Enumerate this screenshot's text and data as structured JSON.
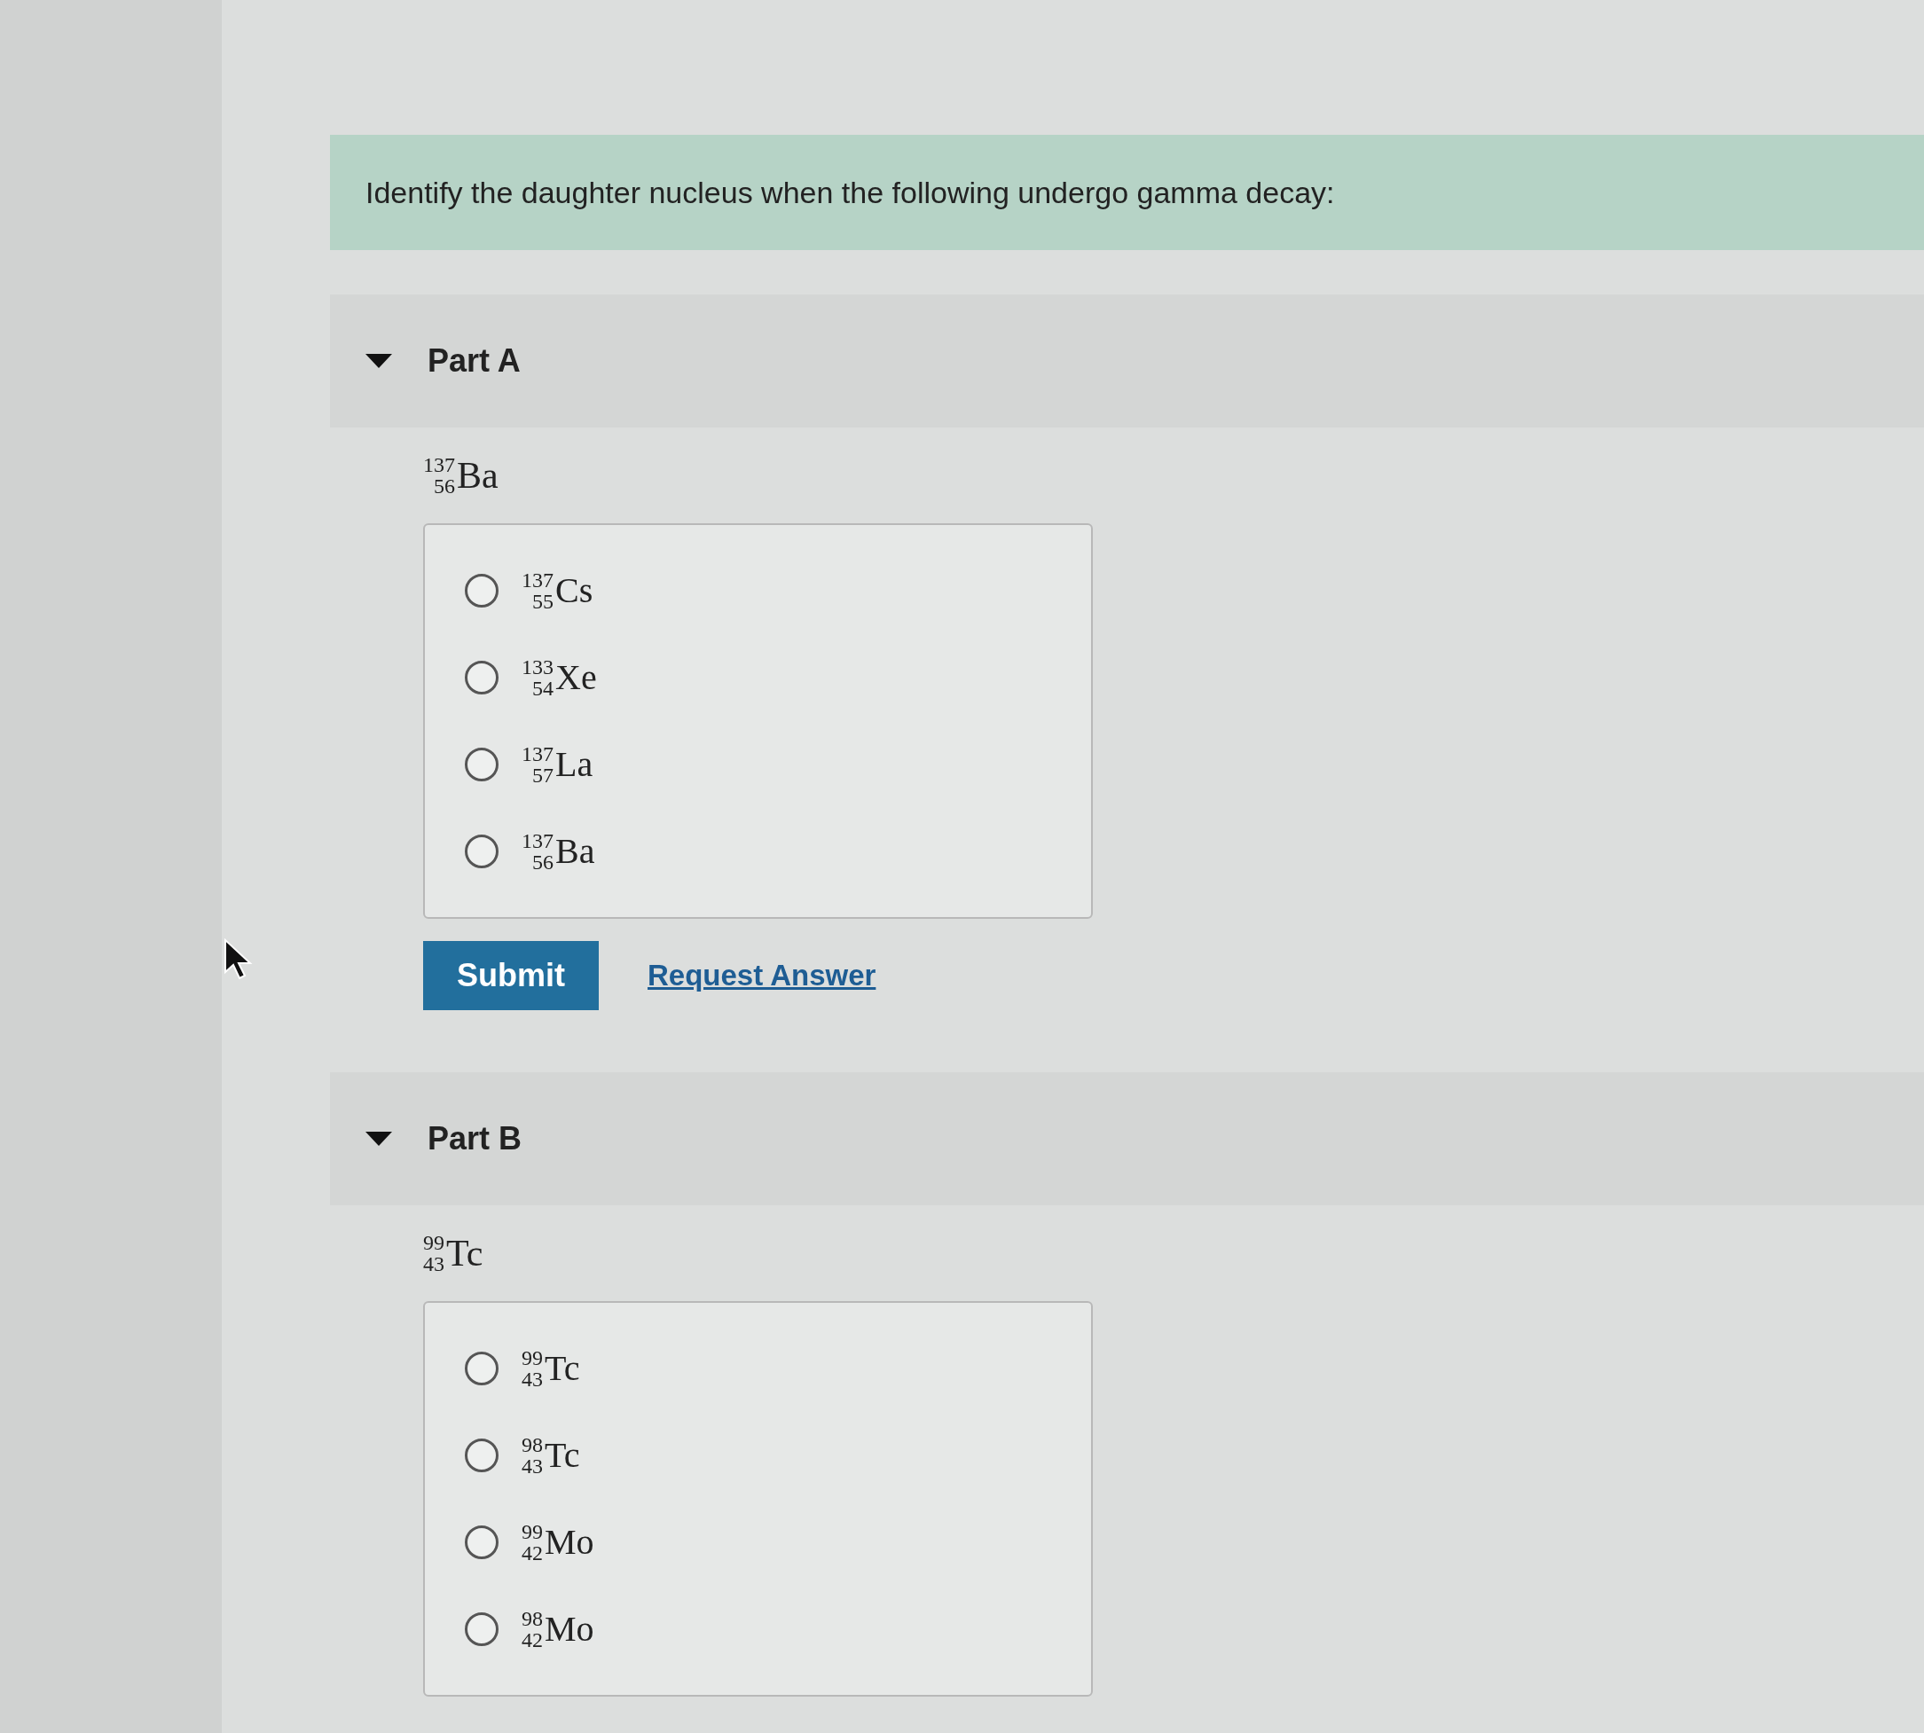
{
  "question": "Identify the daughter nucleus when the following undergo gamma decay:",
  "parts": [
    {
      "title": "Part A",
      "expanded": true,
      "nuclide": {
        "mass": "137",
        "number": "56",
        "symbol": "Ba"
      },
      "options": [
        {
          "mass": "137",
          "number": "55",
          "symbol": "Cs",
          "selected": false
        },
        {
          "mass": "133",
          "number": "54",
          "symbol": "Xe",
          "selected": false
        },
        {
          "mass": "137",
          "number": "57",
          "symbol": "La",
          "selected": false
        },
        {
          "mass": "137",
          "number": "56",
          "symbol": "Ba",
          "selected": false
        }
      ],
      "submit": "Submit",
      "request": "Request Answer"
    },
    {
      "title": "Part B",
      "expanded": true,
      "nuclide": {
        "mass": "99",
        "number": "43",
        "symbol": "Tc"
      },
      "options": [
        {
          "mass": "99",
          "number": "43",
          "symbol": "Tc",
          "selected": false
        },
        {
          "mass": "98",
          "number": "43",
          "symbol": "Tc",
          "selected": false
        },
        {
          "mass": "99",
          "number": "42",
          "symbol": "Mo",
          "selected": false
        },
        {
          "mass": "98",
          "number": "42",
          "symbol": "Mo",
          "selected": false
        }
      ]
    }
  ]
}
